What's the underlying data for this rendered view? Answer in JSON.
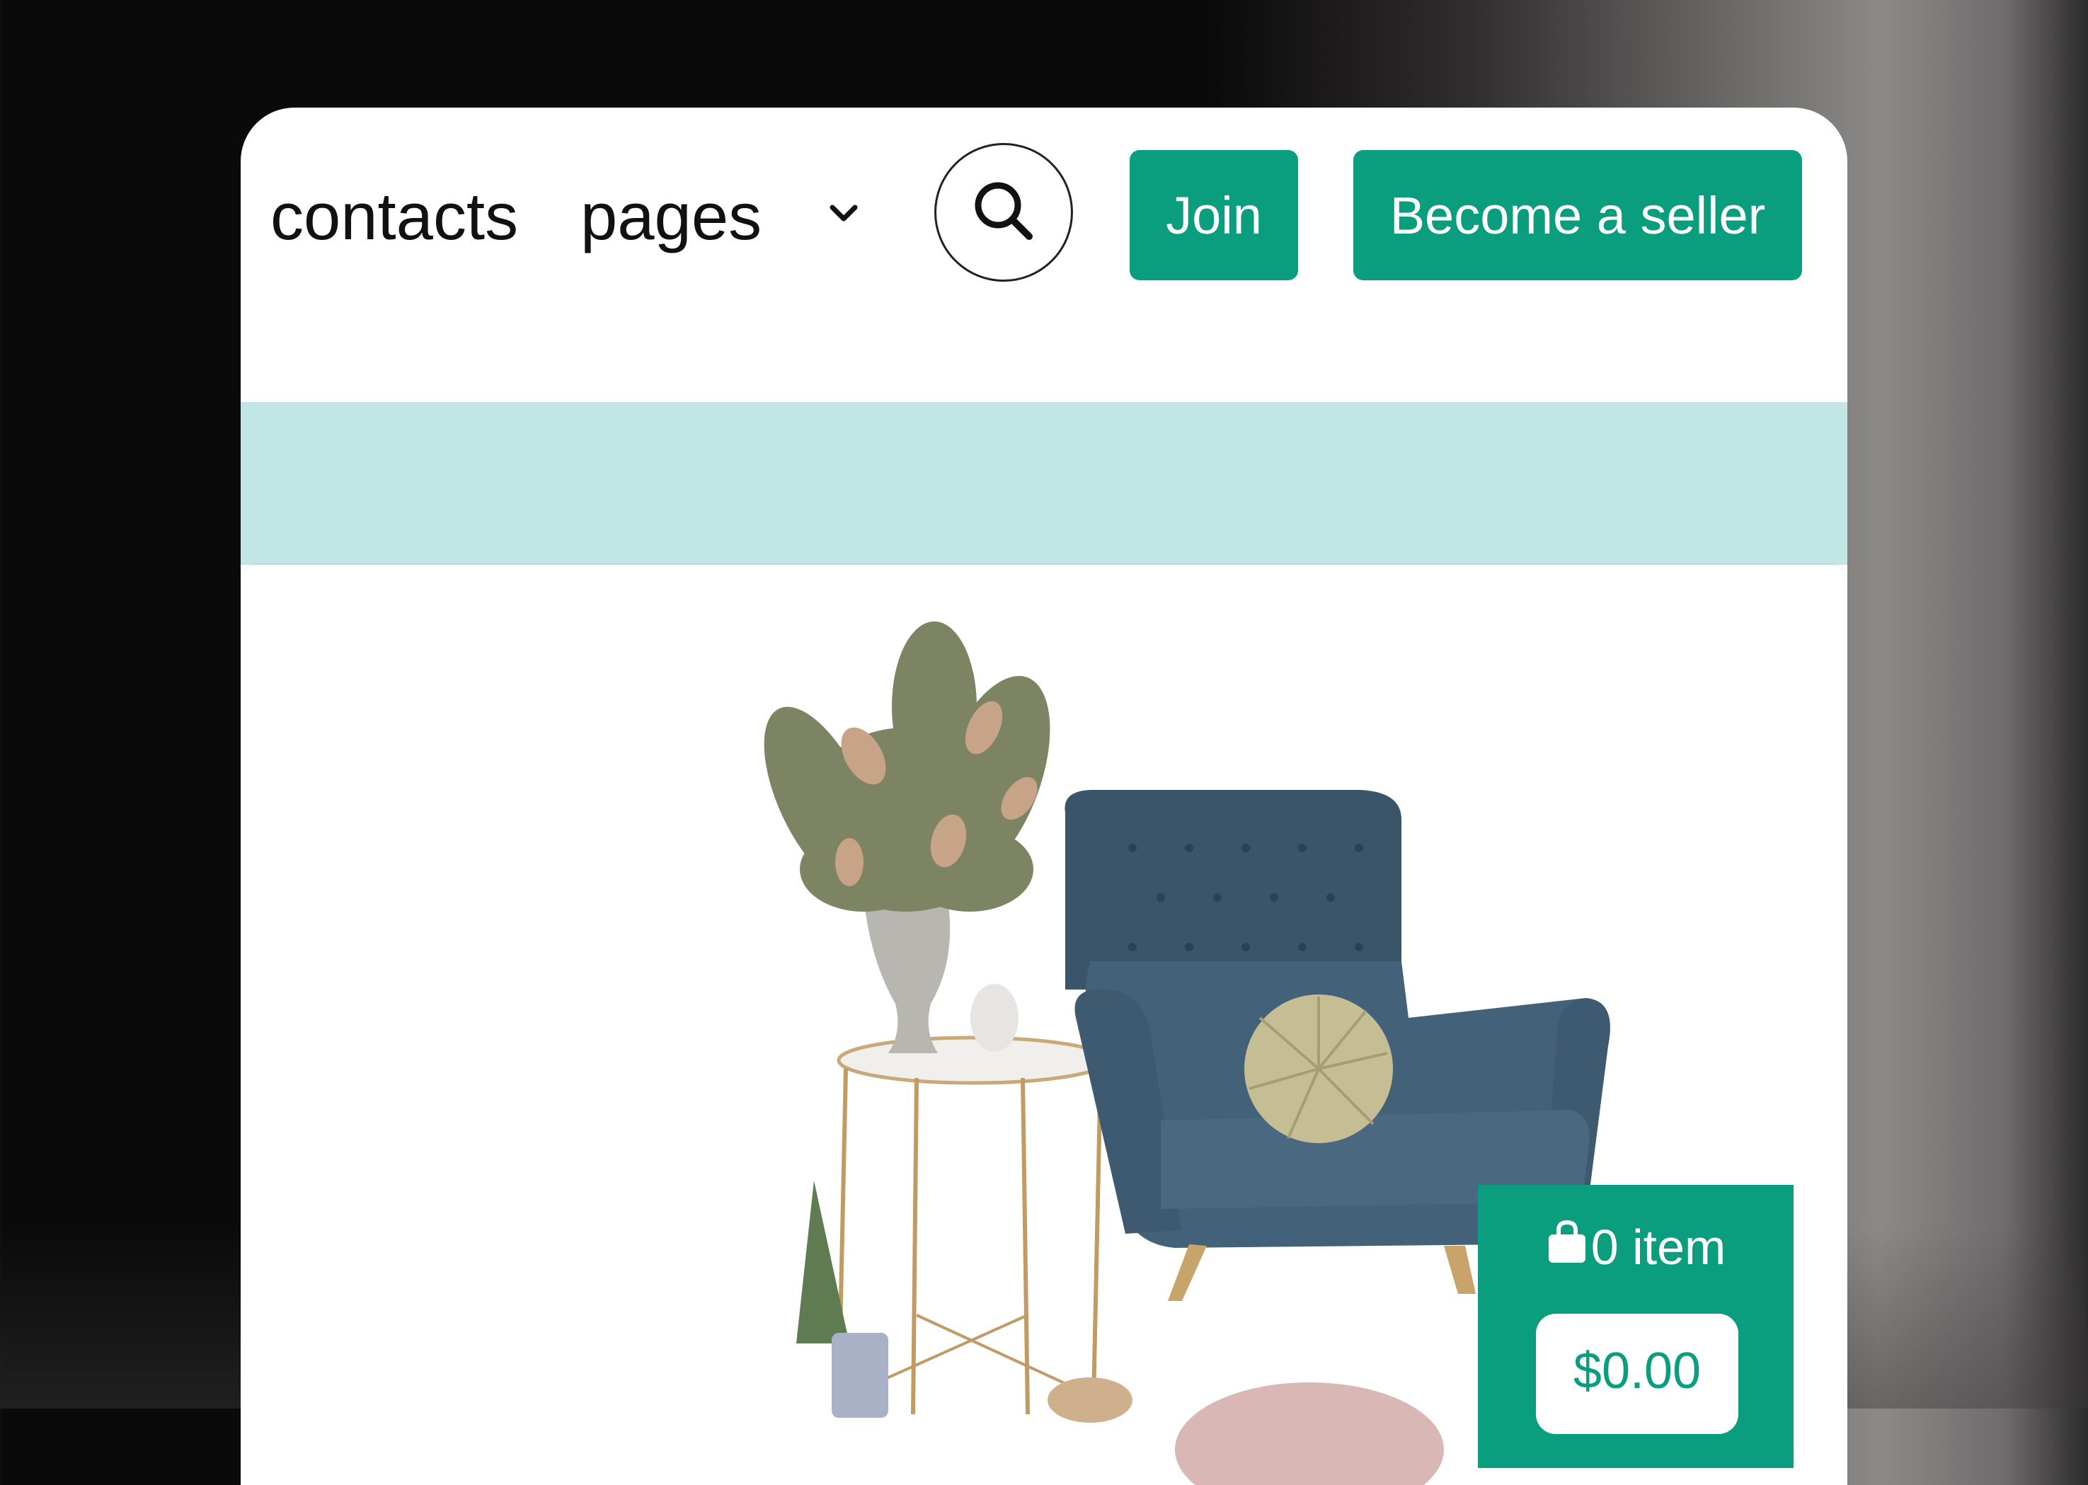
{
  "nav": {
    "contacts_label": "contacts",
    "pages_label": "pages"
  },
  "actions": {
    "join_label": "Join",
    "seller_label": "Become a seller"
  },
  "cart": {
    "items_label": "0 item",
    "total": "$0.00"
  },
  "colors": {
    "accent": "#0a9e7f",
    "band": "#c2e5e5"
  },
  "icons": {
    "search": "search-icon",
    "chevron": "chevron-down-icon",
    "bag": "shopping-bag-icon"
  }
}
